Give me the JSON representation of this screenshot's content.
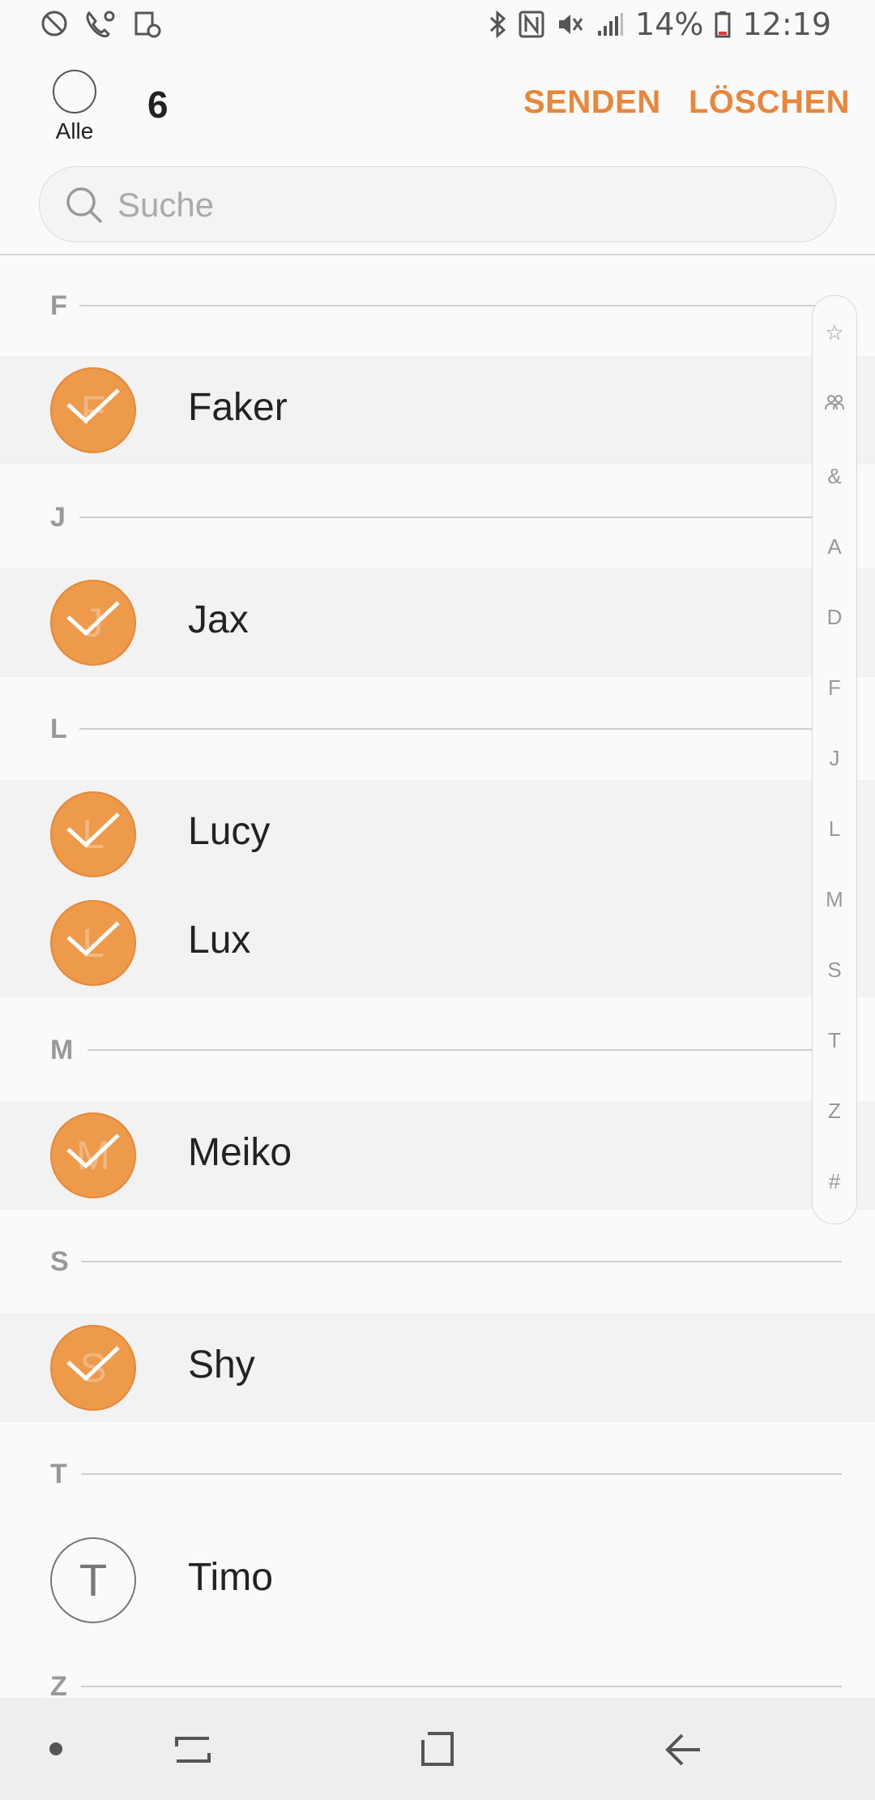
{
  "status_bar": {
    "battery": "14%",
    "time": "12:19"
  },
  "header": {
    "select_all_label": "Alle",
    "selected_count": "6",
    "send_label": "SENDEN",
    "delete_label": "LÖSCHEN"
  },
  "search": {
    "placeholder": "Suche"
  },
  "sections": [
    {
      "letter": "F",
      "contacts": [
        {
          "name": "Faker",
          "initial": "F",
          "checked": true
        }
      ]
    },
    {
      "letter": "J",
      "contacts": [
        {
          "name": "Jax",
          "initial": "J",
          "checked": true
        }
      ]
    },
    {
      "letter": "L",
      "contacts": [
        {
          "name": "Lucy",
          "initial": "L",
          "checked": true
        },
        {
          "name": "Lux",
          "initial": "L",
          "checked": true
        }
      ]
    },
    {
      "letter": "M",
      "contacts": [
        {
          "name": "Meiko",
          "initial": "M",
          "checked": true
        }
      ]
    },
    {
      "letter": "S",
      "contacts": [
        {
          "name": "Shy",
          "initial": "S",
          "checked": true
        }
      ]
    },
    {
      "letter": "T",
      "contacts": [
        {
          "name": "Timo",
          "initial": "T",
          "checked": false
        }
      ]
    },
    {
      "letter": "Z",
      "contacts": []
    }
  ],
  "index_bar": [
    "☆",
    "group-icon",
    "&",
    "A",
    "D",
    "F",
    "J",
    "L",
    "M",
    "S",
    "T",
    "Z",
    "#"
  ],
  "colors": {
    "accent": "#e8873b",
    "checked_avatar": "#ed9a4b"
  }
}
